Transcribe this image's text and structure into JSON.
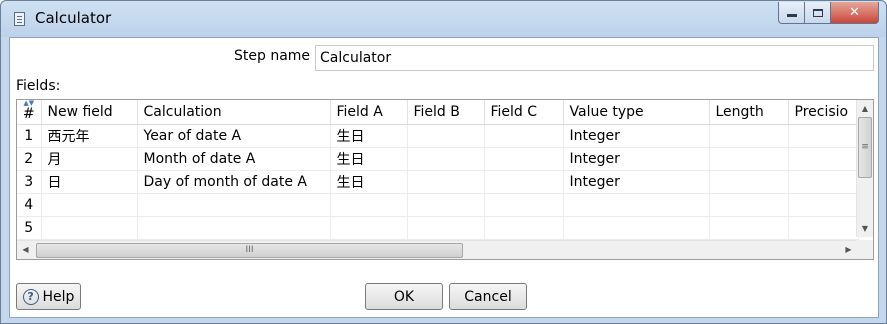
{
  "window": {
    "title": "Calculator",
    "controls": {
      "minimize": "minimize",
      "maximize": "maximize",
      "close": "✕"
    }
  },
  "form": {
    "step_name_label": "Step name",
    "step_name_value": "Calculator",
    "fields_label": "Fields:"
  },
  "table": {
    "headers": [
      "#",
      "New field",
      "Calculation",
      "Field A",
      "Field B",
      "Field C",
      "Value type",
      "Length",
      "Precisio"
    ],
    "rows": [
      [
        "1",
        "西元年",
        "Year of date A",
        "生日",
        "",
        "",
        "Integer",
        "",
        ""
      ],
      [
        "2",
        "月",
        "Month of date A",
        "生日",
        "",
        "",
        "Integer",
        "",
        ""
      ],
      [
        "3",
        "日",
        "Day of month of date A",
        "生日",
        "",
        "",
        "Integer",
        "",
        ""
      ],
      [
        "4",
        "",
        "",
        "",
        "",
        "",
        "",
        "",
        ""
      ],
      [
        "5",
        "",
        "",
        "",
        "",
        "",
        "",
        "",
        ""
      ]
    ]
  },
  "buttons": {
    "help": "Help",
    "ok": "OK",
    "cancel": "Cancel"
  },
  "icons": {
    "app": "calculator-document-icon",
    "help": "question-circle-icon",
    "sort": "sort-icon"
  },
  "colors": {
    "title_bar": "#c4d7ec",
    "close_button": "#c9463a",
    "client_background": "#ffffff"
  }
}
